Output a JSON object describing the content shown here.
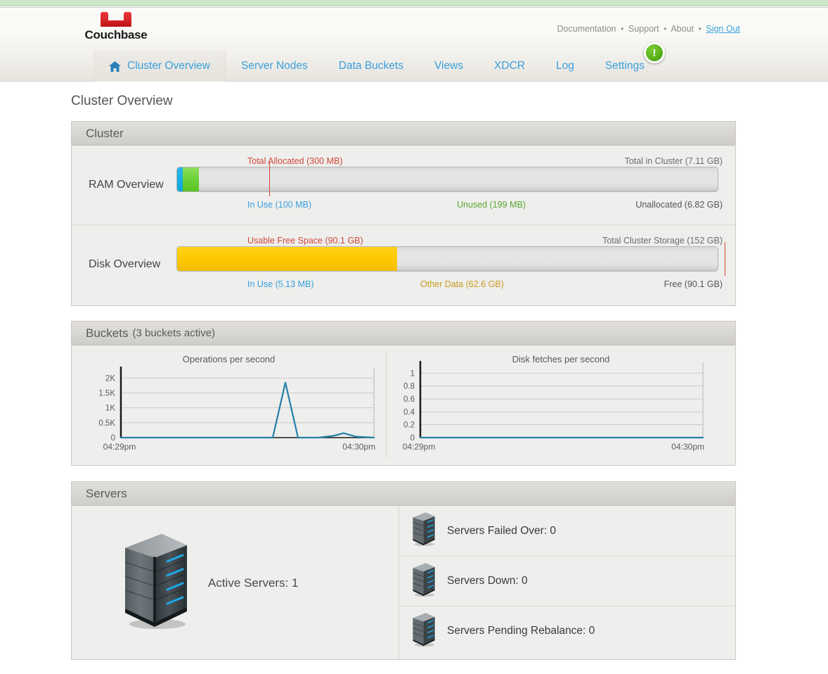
{
  "brand": {
    "name": "Couchbase"
  },
  "top_links": {
    "items": [
      {
        "label": "Documentation",
        "kind": "plain"
      },
      {
        "label": "Support",
        "kind": "plain"
      },
      {
        "label": "About",
        "kind": "plain"
      },
      {
        "label": "Sign Out",
        "kind": "signout"
      }
    ],
    "separator": "•"
  },
  "nav": {
    "tabs": [
      {
        "label": "Cluster Overview",
        "icon": "home-icon",
        "active": true
      },
      {
        "label": "Server Nodes",
        "active": false
      },
      {
        "label": "Data Buckets",
        "active": false
      },
      {
        "label": "Views",
        "active": false
      },
      {
        "label": "XDCR",
        "active": false
      },
      {
        "label": "Log",
        "active": false
      },
      {
        "label": "Settings",
        "active": false
      }
    ],
    "badge": {
      "glyph": "!",
      "color": "#5bb318"
    }
  },
  "page": {
    "title": "Cluster Overview"
  },
  "cluster": {
    "panel_title": "Cluster",
    "ram": {
      "label": "RAM Overview",
      "top_left": "Total Allocated (300 MB)",
      "top_right": "Total in Cluster (7.11 GB)",
      "bottom_left": "In Use (100 MB)",
      "bottom_center": "Unused (199 MB)",
      "bottom_right": "Unallocated (6.82 GB)"
    },
    "disk": {
      "label": "Disk Overview",
      "top_left": "Usable Free Space (90.1 GB)",
      "top_right": "Total Cluster Storage (152 GB)",
      "bottom_left": "In Use (5.13 MB)",
      "bottom_center": "Other Data (62.6 GB)",
      "bottom_right": "Free (90.1 GB)"
    }
  },
  "buckets": {
    "panel_title": "Buckets",
    "panel_subtitle": "(3 buckets active)"
  },
  "chart_data": [
    {
      "type": "line",
      "title": "Operations per second",
      "xlabel": "",
      "ylabel": "",
      "ytick_labels": [
        "2K",
        "1.5K",
        "1K",
        "0.5K",
        "0"
      ],
      "ytick_values": [
        2000,
        1500,
        1000,
        500,
        0
      ],
      "ylim": [
        0,
        2150
      ],
      "xtick_labels": [
        "04:29pm",
        "04:30pm"
      ],
      "grid": true,
      "legend": "none",
      "series": [
        {
          "name": "ops",
          "x": [
            0,
            0.55,
            0.6,
            0.65,
            0.7,
            0.78,
            0.84,
            0.88,
            0.93,
            1.0
          ],
          "values": [
            0,
            0,
            0,
            1850,
            0,
            0,
            60,
            150,
            30,
            0
          ]
        }
      ]
    },
    {
      "type": "line",
      "title": "Disk fetches per second",
      "xlabel": "",
      "ylabel": "",
      "ytick_labels": [
        "1",
        "0.8",
        "0.6",
        "0.4",
        "0.2",
        "0"
      ],
      "ytick_values": [
        1,
        0.8,
        0.6,
        0.4,
        0.2,
        0
      ],
      "ylim": [
        0,
        1.08
      ],
      "xtick_labels": [
        "04:29pm",
        "04:30pm"
      ],
      "grid": true,
      "legend": "none",
      "series": [
        {
          "name": "disk fetches",
          "x": [
            0,
            0.25,
            0.5,
            0.75,
            1.0
          ],
          "values": [
            0,
            0,
            0,
            0,
            0
          ]
        }
      ]
    }
  ],
  "servers": {
    "panel_title": "Servers",
    "active": {
      "label": "Active Servers: 1",
      "icon": "server-rack-icon"
    },
    "stats": [
      {
        "label": "Servers Failed Over: 0",
        "icon": "server-rack-icon"
      },
      {
        "label": "Servers Down: 0",
        "icon": "server-rack-icon"
      },
      {
        "label": "Servers Pending Rebalance: 0",
        "icon": "server-rack-icon"
      }
    ]
  }
}
